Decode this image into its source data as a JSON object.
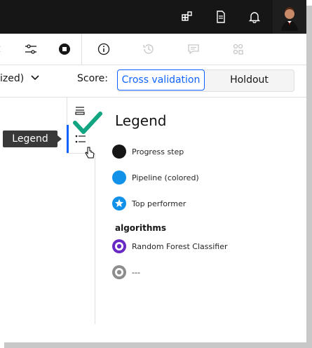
{
  "scoring": {
    "metric_suffix": "ized)",
    "score_label": "Score:",
    "cross_validation": "Cross validation",
    "holdout": "Holdout"
  },
  "tooltip": {
    "text": "Legend"
  },
  "legend": {
    "title": "Legend",
    "items": [
      {
        "label": "Progress step",
        "color": "#161616"
      },
      {
        "label": "Pipeline (colored)",
        "color": "#1192e8"
      },
      {
        "label": "Top performer",
        "color": "#1192e8"
      }
    ],
    "group_title": "algorithms",
    "algorithms": [
      {
        "label": "Random Forest Classifier",
        "color": "#6929c4"
      },
      {
        "label": "---",
        "color": "#8d8d8d"
      }
    ]
  },
  "colors": {
    "accent": "#0f62fe",
    "checkmark": "#12a581",
    "topbar": "#161616"
  },
  "icons": {
    "topbar": [
      "apps-icon",
      "document-icon",
      "notification-icon",
      "user-avatar"
    ],
    "toolbar": [
      "swap-icon",
      "settings-adjust-icon",
      "stop-icon",
      "information-icon",
      "history-icon",
      "comment-icon",
      "summary-icon"
    ],
    "rail": [
      "list-icon",
      "legend-list-icon"
    ]
  }
}
